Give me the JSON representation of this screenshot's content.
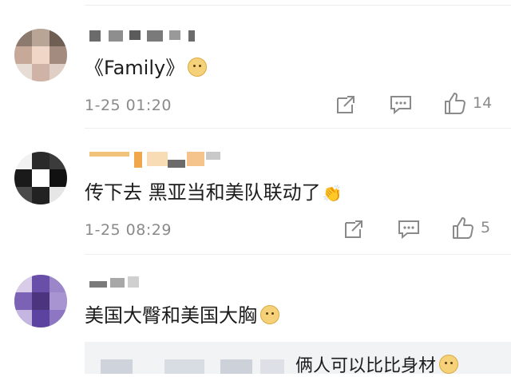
{
  "comments": [
    {
      "text": "《Family》",
      "emoji": "doge-emoji",
      "timestamp": "1-25 01:20",
      "likes": "14"
    },
    {
      "text": "传下去 黑亚当和美队联动了",
      "emoji": "clap-emoji",
      "timestamp": "1-25 08:29",
      "likes": "5"
    },
    {
      "text": "美国大臀和美国大胸",
      "emoji": "doge-emoji"
    }
  ],
  "reply": {
    "text": "俩人可以比比身材",
    "emoji": "doge-emoji"
  },
  "icons": {
    "share": "share-icon",
    "comment": "comment-icon",
    "like": "thumbs-up-icon"
  },
  "colors": {
    "meta_text": "#8a8a8a",
    "divider": "#eeeeee",
    "reply_background": "#f2f3f5"
  }
}
